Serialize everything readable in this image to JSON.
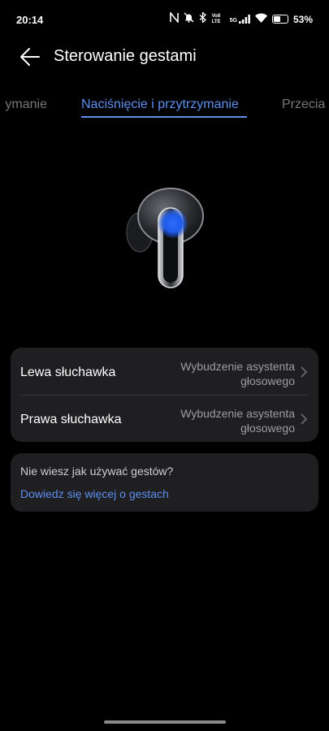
{
  "status_bar": {
    "time": "20:14",
    "icons": [
      "nfc-icon",
      "mute-icon",
      "bluetooth-icon",
      "volte-icon",
      "5g-signal-icon",
      "wifi-icon",
      "battery-icon"
    ],
    "volte_label": "Vo8 LTE",
    "network_label": "5G",
    "battery_percent": 53,
    "battery_text": "53%"
  },
  "app_bar": {
    "title": "Sterowanie gestami"
  },
  "tabs": {
    "left_partial": "ymanie",
    "active": "Naciśnięcie i przytrzymanie",
    "right_partial": "Przecia"
  },
  "settings": {
    "items": [
      {
        "label": "Lewa słuchawka",
        "value": "Wybudzenie asystenta głosowego"
      },
      {
        "label": "Prawa słuchawka",
        "value": "Wybudzenie asystenta głosowego"
      }
    ]
  },
  "help": {
    "question": "Nie wiesz jak używać gestów?",
    "link": "Dowiedz się więcej o gestach"
  },
  "colors": {
    "accent": "#5d8ff0",
    "background": "#000000",
    "card": "#1f1f21",
    "secondary_text": "#9d9d9d"
  }
}
